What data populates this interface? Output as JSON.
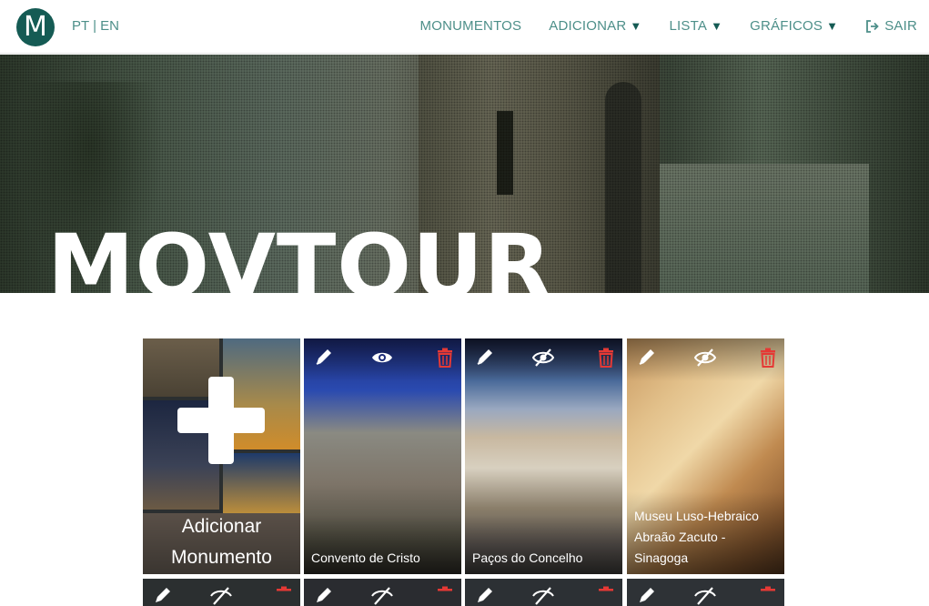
{
  "brand": {
    "logo_letter": "M"
  },
  "lang": {
    "pt": "PT",
    "sep": "|",
    "en": "EN"
  },
  "nav": {
    "monumentos": "MONUMENTOS",
    "adicionar": "ADICIONAR",
    "lista": "LISTA",
    "graficos": "GRÁFICOS",
    "sair": "SAIR",
    "caret": "▼"
  },
  "hero": {
    "title": "MOVTOUR"
  },
  "cards": {
    "add": {
      "label_line1": "Adicionar",
      "label_line2": "Monumento"
    },
    "items": [
      {
        "name": "Convento de Cristo",
        "visibility": "visible"
      },
      {
        "name": "Paços do Concelho",
        "visibility": "hidden"
      },
      {
        "name": "Museu Luso-Hebraico Abraão Zacuto - Sinagoga",
        "visibility": "hidden"
      }
    ]
  },
  "colors": {
    "primary": "#155b54",
    "nav_text": "#4d8f89",
    "delete": "#e53935"
  }
}
